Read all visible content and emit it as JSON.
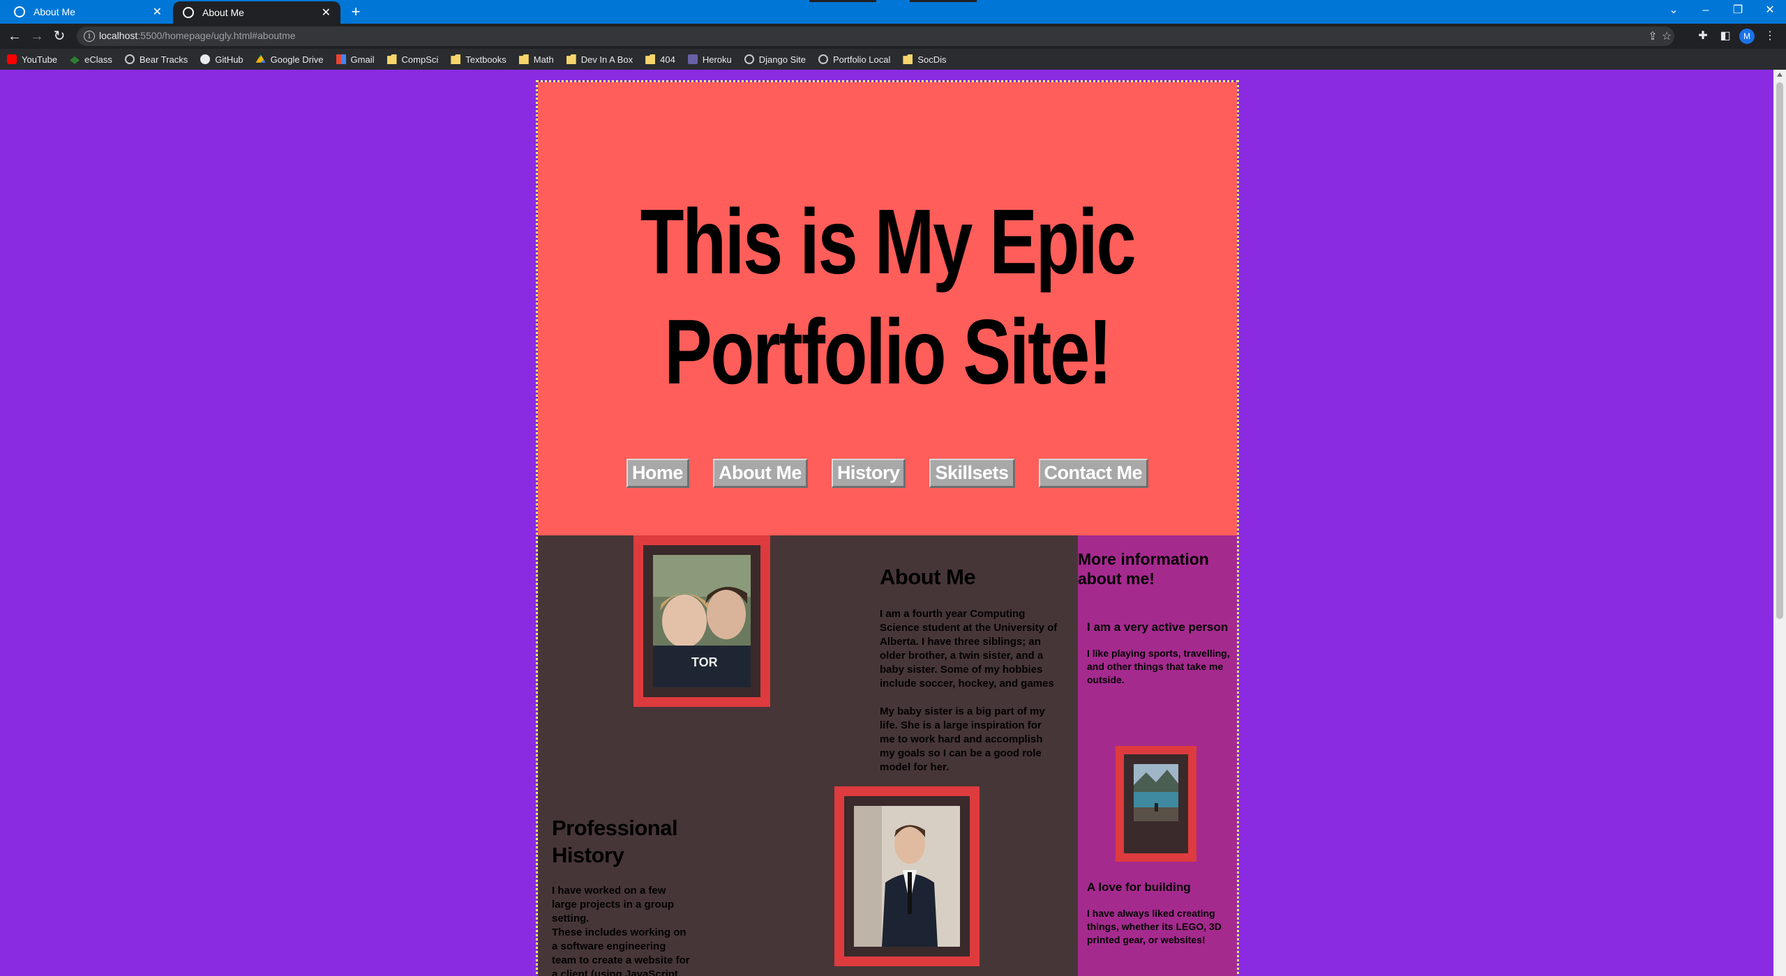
{
  "browser": {
    "tabs": [
      {
        "title": "About Me",
        "active": false
      },
      {
        "title": "About Me",
        "active": true
      }
    ],
    "new_tab_symbol": "+",
    "address": {
      "host": "localhost",
      "path": ":5500/homepage/ugly.html#aboutme"
    },
    "profile_initial": "M",
    "bookmarks": [
      {
        "label": "YouTube",
        "icon": "youtube-icon"
      },
      {
        "label": "eClass",
        "icon": "eclass-icon"
      },
      {
        "label": "Bear Tracks",
        "icon": "globe-icon"
      },
      {
        "label": "GitHub",
        "icon": "github-icon"
      },
      {
        "label": "Google Drive",
        "icon": "google-drive-icon"
      },
      {
        "label": "Gmail",
        "icon": "gmail-icon"
      },
      {
        "label": "CompSci",
        "icon": "folder-icon"
      },
      {
        "label": "Textbooks",
        "icon": "folder-icon"
      },
      {
        "label": "Math",
        "icon": "folder-icon"
      },
      {
        "label": "Dev In A Box",
        "icon": "folder-icon"
      },
      {
        "label": "404",
        "icon": "folder-icon"
      },
      {
        "label": "Heroku",
        "icon": "heroku-icon"
      },
      {
        "label": "Django Site",
        "icon": "globe-icon"
      },
      {
        "label": "Portfolio Local",
        "icon": "globe-icon"
      },
      {
        "label": "SocDis",
        "icon": "folder-icon"
      }
    ]
  },
  "colors": {
    "chrome_blue": "#0077d6",
    "page_bg": "#8a2be2",
    "hero_bg": "#ff5e5a",
    "content_bg": "#473637",
    "aside_bg": "#a52a8e",
    "frame_red": "#dd3b3e",
    "border_dotted": "#ffff66"
  },
  "site": {
    "title": "This is My Epic Portfolio Site!",
    "nav": [
      "Home",
      "About Me",
      "History",
      "Skillsets",
      "Contact Me"
    ],
    "about": {
      "heading": "About Me",
      "para1": "I am a fourth year Computing Science student at the University of Alberta. I have three siblings; an older brother, a twin sister, and a baby sister. Some of my hobbies include soccer, hockey, and games",
      "para2": "My baby sister is a big part of my life. She is a large inspiration for me to work hard and accomplish my goals so I can be a good role model for her."
    },
    "professional": {
      "heading": "Professional History",
      "para1": "I have worked on a few large projects in a group setting.",
      "para2": "These includes working on a software engineering team to create a website for a client (using JavaScript, React, and"
    },
    "aside": {
      "heading": "More information about me!",
      "sub1": "I am a very active person",
      "para1": "I like playing sports, travelling, and other things that take me outside.",
      "sub2": "A love for building",
      "para2": "I have always liked creating things, whether its LEGO, 3D printed gear, or websites!"
    }
  }
}
